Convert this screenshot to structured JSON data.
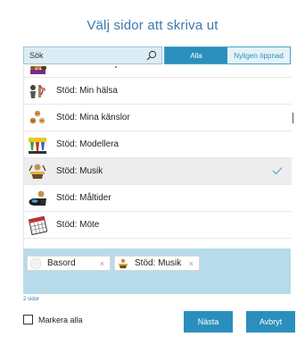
{
  "dialog": {
    "title": "Välj sidor att skriva ut"
  },
  "search": {
    "value": "Sök",
    "placeholder": "Sök"
  },
  "filters": {
    "all_label": "Alla",
    "recent_label": "Nyligen öppnad",
    "active": "Alla"
  },
  "list": {
    "items": [
      {
        "label": "Stöd: Min familj",
        "icon": "family-icon",
        "selected": false,
        "partially_visible": true
      },
      {
        "label": "Stöd: Min hälsa",
        "icon": "health-icon",
        "selected": false
      },
      {
        "label": "Stöd: Mina känslor",
        "icon": "emotions-icon",
        "selected": false
      },
      {
        "label": "Stöd: Modellera",
        "icon": "clay-modelling-icon",
        "selected": false
      },
      {
        "label": "Stöd: Musik",
        "icon": "music-icon",
        "selected": true
      },
      {
        "label": "Stöd: Måltider",
        "icon": "meal-icon",
        "selected": false
      },
      {
        "label": "Stöd: Möte",
        "icon": "calendar-icon",
        "selected": false
      }
    ],
    "check_color": "#4aa7c8"
  },
  "selected_tray": {
    "chips": [
      {
        "label": "Basord",
        "icon": "blank-circle-icon",
        "remove": "×"
      },
      {
        "label": "Stöd: Musik",
        "icon": "music-icon",
        "remove": "×"
      }
    ],
    "count_text": "2 sidor",
    "background": "#b7dbe8"
  },
  "footer": {
    "select_all_label": "Markera alla",
    "next_label": "Nästa",
    "cancel_label": "Avbryt"
  },
  "colors": {
    "accent": "#2a8fbd",
    "title": "#3a78b0",
    "search_bg": "#dcecf5"
  }
}
